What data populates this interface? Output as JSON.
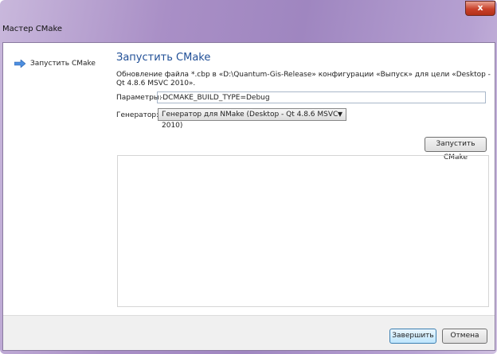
{
  "window": {
    "title": "Мастер CMake",
    "close": "x"
  },
  "sidebar": {
    "items": [
      {
        "label": "Запустить CMake"
      }
    ]
  },
  "page": {
    "heading": "Запустить CMake",
    "description": "Обновление файла *.cbp в «D:\\Quantum-Gis-Release» конфигурации «Выпуск» для цели «Desktop - Qt 4.8.6 MSVC 2010».",
    "params_label": "Параметры:",
    "params_value": "-DCMAKE_BUILD_TYPE=Debug",
    "generator_label": "Генератор:",
    "generator_value": "Генератор для NMake (Desktop - Qt 4.8.6 MSVC 2010)",
    "run_button": "Запустить CMake",
    "output": ""
  },
  "footer": {
    "finish": "Завершить",
    "cancel": "Отмена"
  }
}
